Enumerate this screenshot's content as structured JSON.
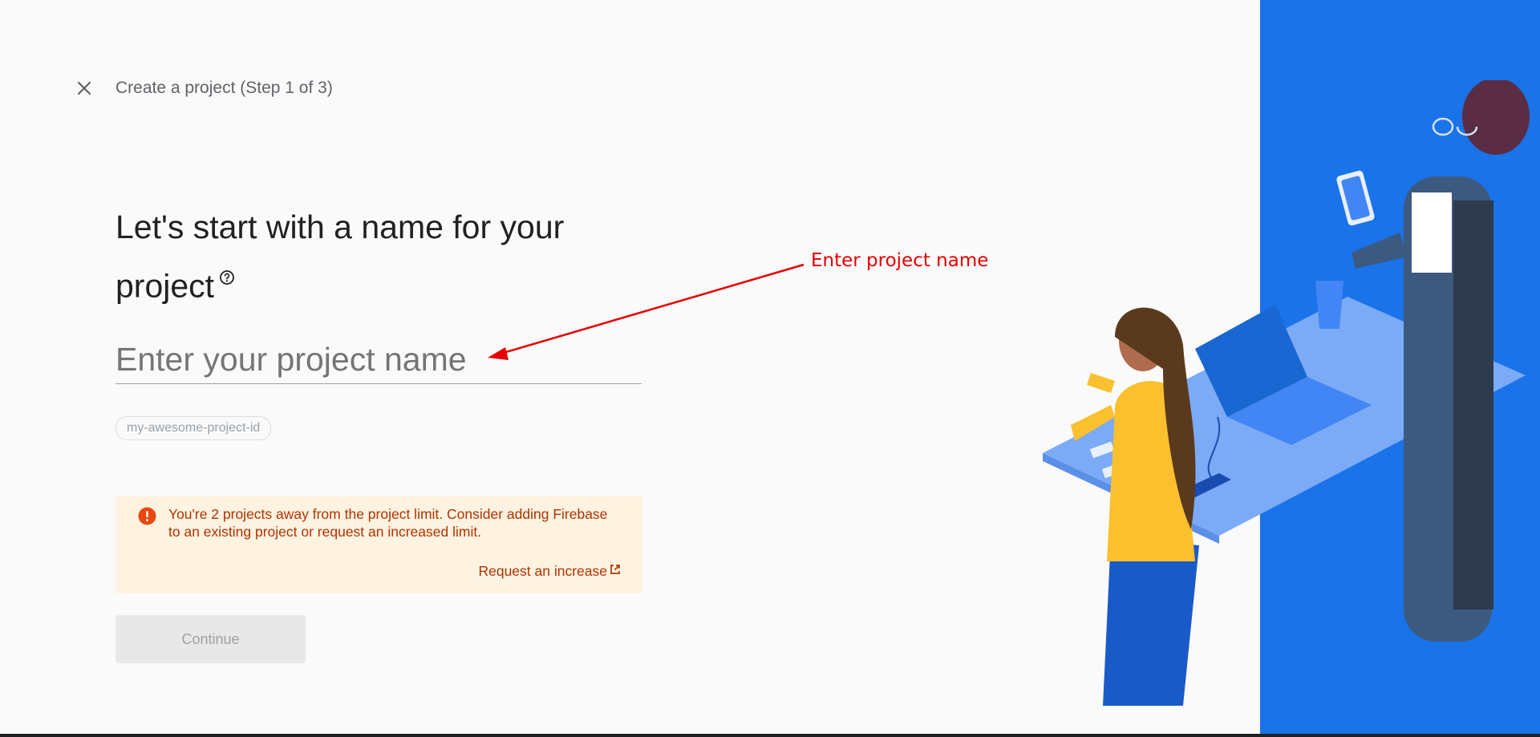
{
  "header": {
    "close_icon": "close-icon",
    "step_title": "Create a project (Step 1 of 3)"
  },
  "main": {
    "heading": "Let's start with a name for your project",
    "help_icon": "help-circle-icon",
    "name_input": {
      "placeholder": "Enter your project name",
      "value": ""
    },
    "project_id": "my-awesome-project-id"
  },
  "warning": {
    "icon": "error-icon",
    "text": "You're 2 projects away from the project limit. Consider adding Firebase to an existing project or request an increased limit.",
    "link_label": "Request an increase",
    "link_icon": "external-link-icon"
  },
  "actions": {
    "continue_label": "Continue"
  },
  "annotation": {
    "label": "Enter project name"
  },
  "colors": {
    "brand_blue": "#1a73e8",
    "warning_bg": "#fef3e1",
    "warning_text": "#b23200",
    "annotation_red": "#e60000"
  }
}
